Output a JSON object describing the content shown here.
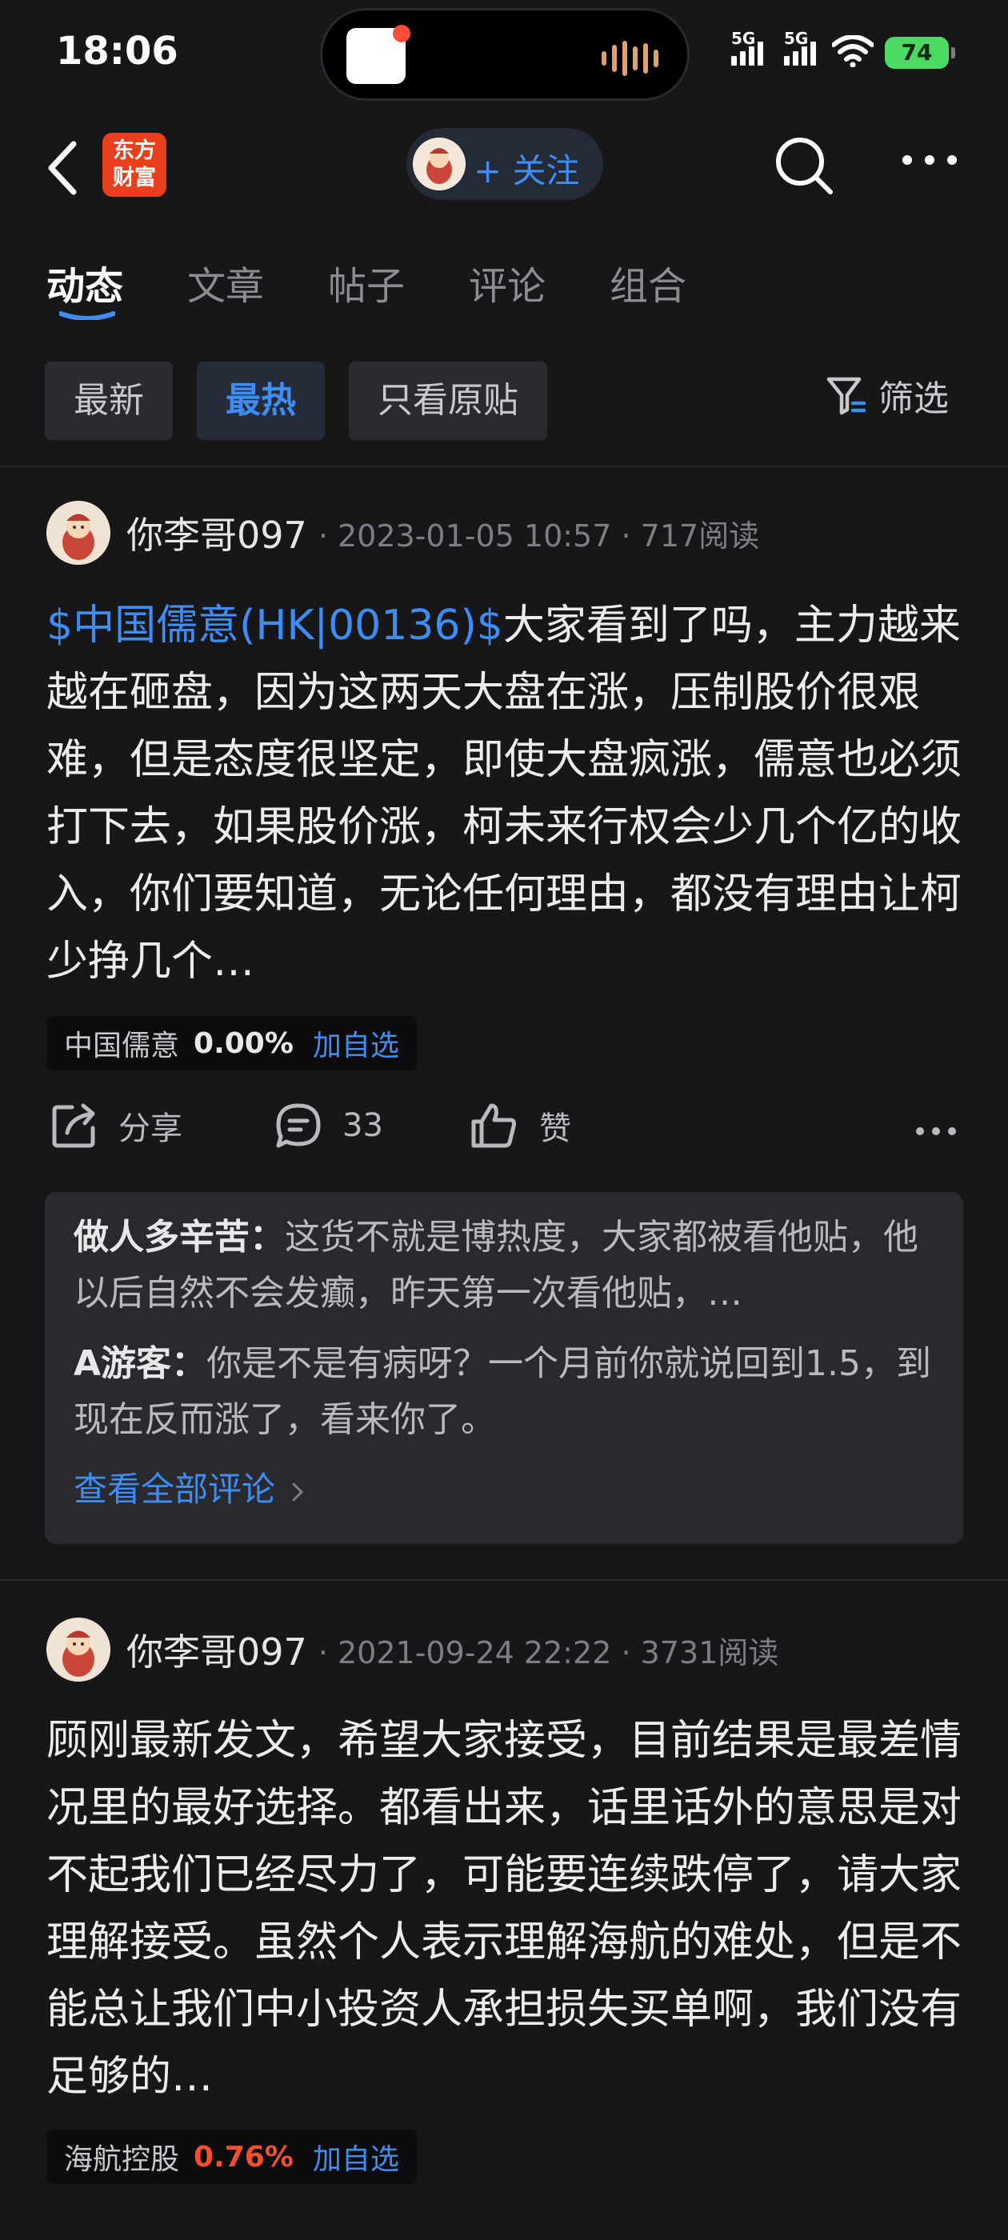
{
  "status": {
    "time": "18:06",
    "signal1": "5G",
    "signal2": "5G",
    "battery": "74"
  },
  "nav": {
    "app_logo_line1": "东方",
    "app_logo_line2": "财富",
    "follow_label": "+ 关注"
  },
  "tabs": [
    {
      "label": "动态",
      "active": true
    },
    {
      "label": "文章",
      "active": false
    },
    {
      "label": "帖子",
      "active": false
    },
    {
      "label": "评论",
      "active": false
    },
    {
      "label": "组合",
      "active": false
    }
  ],
  "filters": {
    "chips": [
      "最新",
      "最热",
      "只看原贴"
    ],
    "active_index": 1,
    "filter_label": "筛选"
  },
  "posts": [
    {
      "author": "你李哥097",
      "time": "2023-01-05 10:57",
      "reads": "717阅读",
      "stock_link": "$中国儒意(HK|00136)$",
      "body": "大家看到了吗，主力越来越在砸盘，因为这两天大盘在涨，压制股价很艰难，但是态度很坚定，即使大盘疯涨，儒意也必须打下去，如果股价涨，柯未来行权会少几个亿的收入，你们要知道，无论任何理由，都没有理由让柯少挣几个…",
      "tag": {
        "name": "中国儒意",
        "change": "0.00%",
        "change_color": "#e8e8ea",
        "add": "加自选"
      },
      "share": "分享",
      "comment_count": "33",
      "like": "赞",
      "comments": [
        {
          "user": "做人多辛苦：",
          "text": "这货不就是博热度，大家都被看他贴，他以后自然不会发癫，昨天第一次看他贴，…"
        },
        {
          "user": "A游客：",
          "text": "你是不是有病呀？一个月前你就说回到1.5，到现在反而涨了，看来你了。"
        }
      ],
      "view_all": "查看全部评论"
    },
    {
      "author": "你李哥097",
      "time": "2021-09-24 22:22",
      "reads": "3731阅读",
      "body": "顾刚最新发文，希望大家接受，目前结果是最差情况里的最好选择。都看出来，话里话外的意思是对不起我们已经尽力了，可能要连续跌停了，请大家理解接受。虽然个人表示理解海航的难处，但是不能总让我们中小投资人承担损失买单啊，我们没有足够的…",
      "tag": {
        "name": "海航控股",
        "change": "0.76%",
        "change_color": "#f0502e",
        "add": "加自选"
      }
    }
  ]
}
